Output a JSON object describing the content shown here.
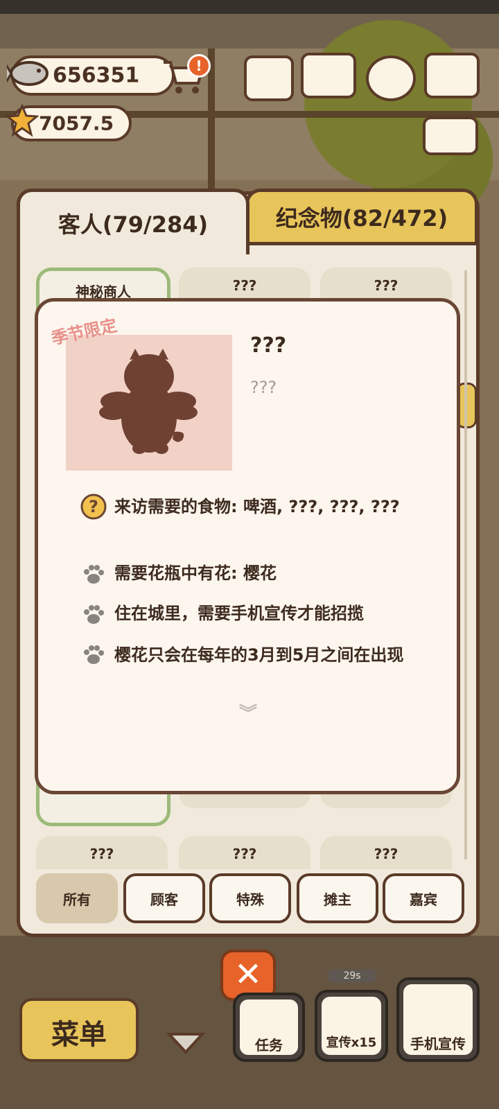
{
  "currency": {
    "fish": "656351",
    "stars": "7057.5"
  },
  "tabs": {
    "guests": "客人(79/284)",
    "souvenirs": "纪念物(82/472)"
  },
  "grid": {
    "row1": [
      "神秘商人",
      "???",
      "???"
    ],
    "row3": [
      "???",
      "???",
      "???"
    ]
  },
  "detail": {
    "stamp": "季节限定",
    "name": "???",
    "subtitle": "???",
    "requirements": [
      "来访需要的食物: 啤酒, ???, ???, ???",
      "需要花瓶中有花: 樱花",
      "住在城里，需要手机宣传才能招揽",
      "樱花只会在每年的3月到5月之间在出现"
    ]
  },
  "filters": [
    "所有",
    "顾客",
    "特殊",
    "摊主",
    "嘉宾"
  ],
  "bottom": {
    "menu": "菜单",
    "tasks": "任务",
    "promo_count": "宣传x15",
    "phone_promo": "手机宣传",
    "timer": "29s"
  },
  "colors": {
    "accent_yellow": "#e8c55a",
    "frame_brown": "#5a3a28",
    "paper": "#fcf6ee",
    "close_orange": "#e8632a"
  }
}
